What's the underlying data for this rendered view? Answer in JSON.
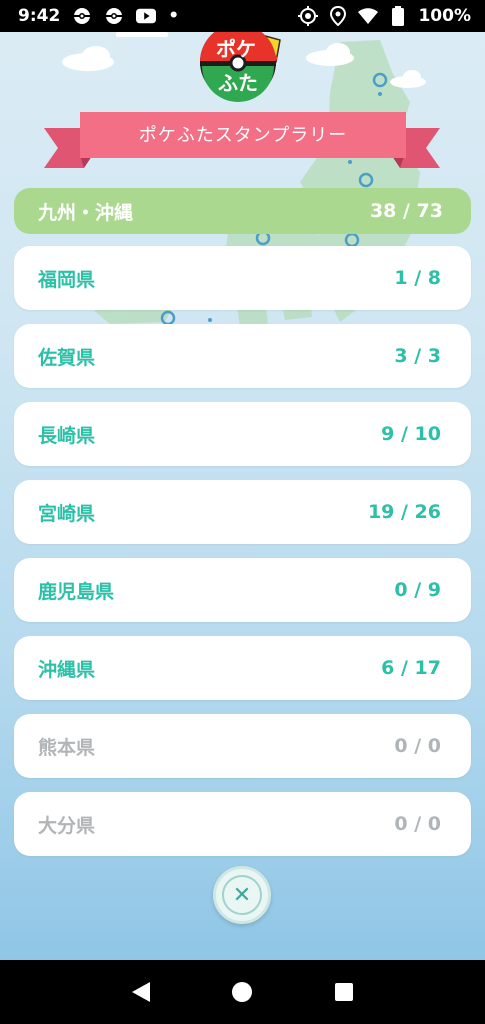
{
  "status_bar": {
    "time": "9:42",
    "dot": "•",
    "battery": "100%",
    "left_icons": [
      "pokemon-go-icon",
      "pokemon-go-icon",
      "youtube-icon"
    ],
    "right_icons": [
      "location-target-icon",
      "location-pin-icon",
      "wifi-icon",
      "battery-icon"
    ]
  },
  "header": {
    "logo_text": "ポケふた",
    "ribbon_title": "ポケふたスタンプラリー",
    "colors": {
      "ribbon": "#f26f86",
      "ribbon_dark": "#e05571"
    }
  },
  "region": {
    "name": "九州・沖縄",
    "count": "38 / 73",
    "color": "#a9d88e"
  },
  "prefectures": [
    {
      "name": "福岡県",
      "count": "1 / 8",
      "enabled": true
    },
    {
      "name": "佐賀県",
      "count": "3 / 3",
      "enabled": true
    },
    {
      "name": "長崎県",
      "count": "9 / 10",
      "enabled": true
    },
    {
      "name": "宮崎県",
      "count": "19 / 26",
      "enabled": true
    },
    {
      "name": "鹿児島県",
      "count": "0 / 9",
      "enabled": true
    },
    {
      "name": "沖縄県",
      "count": "6 / 17",
      "enabled": true
    },
    {
      "name": "熊本県",
      "count": "0 / 0",
      "enabled": false
    },
    {
      "name": "大分県",
      "count": "0 / 0",
      "enabled": false
    }
  ],
  "colors": {
    "accent": "#2cc0a8",
    "disabled": "#b2b5b7"
  },
  "close_button": {
    "icon": "close-icon",
    "glyph": "✕"
  },
  "nav": {
    "icons": [
      "back-icon",
      "home-icon",
      "recents-icon"
    ]
  }
}
